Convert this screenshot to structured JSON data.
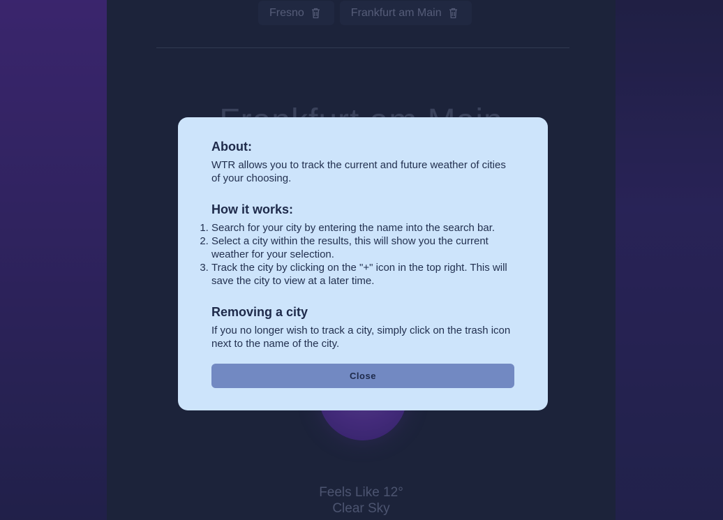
{
  "tracked_cities": [
    {
      "name": "Fresno"
    },
    {
      "name": "Frankfurt am Main"
    }
  ],
  "current_city": "Frankfurt am Main",
  "weather": {
    "feels_like": "Feels Like 12°",
    "condition": "Clear Sky"
  },
  "modal": {
    "about_title": "About:",
    "about_text": "WTR allows you to track the current and future weather of cities of your choosing.",
    "how_title": "How it works:",
    "steps": [
      "Search for your city by entering the name into the search bar.",
      "Select a city within the results, this will show you the current weather for your selection.",
      "Track the city by clicking on the \"+\" icon in the top right. This will save the city to view at a later time."
    ],
    "remove_title": "Removing a city",
    "remove_text": "If you no longer wish to track a city, simply click on the trash icon next to the name of the city.",
    "close_label": "Close"
  },
  "icons": {
    "trash": "trash-icon"
  },
  "colors": {
    "modal_bg": "#cde4fb",
    "button": "#7289c2",
    "accent_purple": "#6a38b8"
  }
}
